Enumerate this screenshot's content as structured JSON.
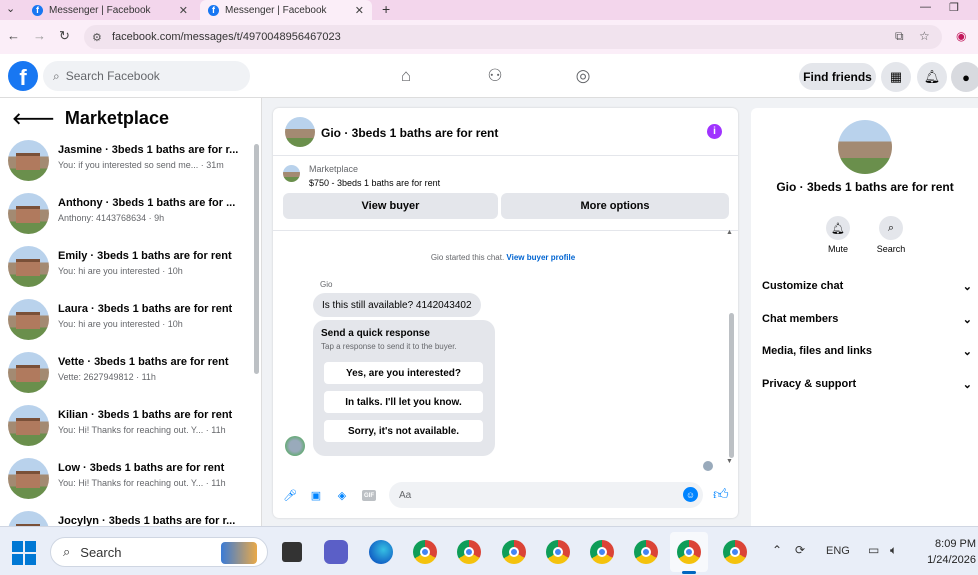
{
  "browser": {
    "tabs": [
      {
        "title": "Messenger | Facebook",
        "active": false
      },
      {
        "title": "Messenger | Facebook",
        "active": true
      }
    ],
    "url": "facebook.com/messages/t/4970048956467023"
  },
  "facebook": {
    "search_placeholder": "Search Facebook",
    "find_friends": "Find friends"
  },
  "left_panel": {
    "title": "Marketplace",
    "conversations": [
      {
        "title": "Jasmine · 3beds 1 baths are for r...",
        "preview": "You: if you interested so send me...",
        "time": "31m"
      },
      {
        "title": "Anthony · 3beds 1 baths are for ...",
        "preview": "Anthony: 4143768634",
        "time": "9h"
      },
      {
        "title": "Emily · 3beds 1 baths are for rent",
        "preview": "You: hi are you interested",
        "time": "10h"
      },
      {
        "title": "Laura · 3beds 1 baths are for rent",
        "preview": "You: hi are you interested",
        "time": "10h"
      },
      {
        "title": "Vette · 3beds 1 baths are for rent",
        "preview": "Vette: 2627949812",
        "time": "11h"
      },
      {
        "title": "Kilian · 3beds 1 baths are for rent",
        "preview": "You: Hi! Thanks for reaching out. Y...",
        "time": "11h"
      },
      {
        "title": "Low · 3beds 1 baths are for rent",
        "preview": "You: Hi! Thanks for reaching out. Y...",
        "time": "11h"
      },
      {
        "title": "Jocylyn · 3beds 1 baths are for r...",
        "preview": "",
        "time": ""
      }
    ]
  },
  "chat": {
    "title": "Gio · 3beds 1 baths are for rent",
    "marketplace_label": "Marketplace",
    "listing": "$750 - 3beds 1 baths are for rent",
    "view_buyer": "View buyer",
    "more_options": "More options",
    "system_msg": "Gio started this chat.",
    "system_link": "View buyer profile",
    "sender": "Gio",
    "message": "Is this still available? 4142043402",
    "quick_title": "Send a quick response",
    "quick_sub": "Tap a response to send it to the buyer.",
    "quick_replies": [
      "Yes, are you interested?",
      "In talks. I'll let you know.",
      "Sorry, it's not available."
    ],
    "input_placeholder": "Aa",
    "gif_label": "GIF"
  },
  "right_panel": {
    "name": "Gio · 3beds 1 baths are for rent",
    "actions": [
      {
        "label": "Mute",
        "icon": "bell-icon"
      },
      {
        "label": "Search",
        "icon": "search-icon"
      }
    ],
    "sections": [
      "Customize chat",
      "Chat members",
      "Media, files and links",
      "Privacy & support"
    ]
  },
  "taskbar": {
    "search": "Search",
    "lang": "ENG",
    "time": "8:09 PM",
    "date": "1/24/2026"
  }
}
